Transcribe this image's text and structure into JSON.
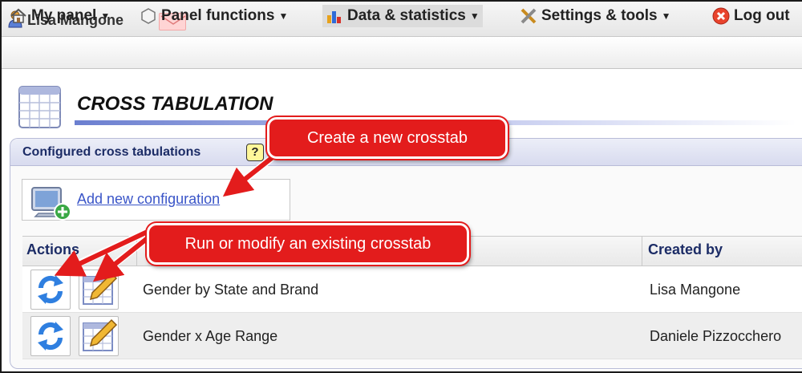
{
  "user": {
    "name": "Lisa Mangone"
  },
  "menu": [
    {
      "label": "My panel",
      "icon": "home-icon"
    },
    {
      "label": "Panel functions",
      "icon": "hexagon-icon"
    },
    {
      "label": "Data & statistics",
      "icon": "chart-icon"
    },
    {
      "label": "Settings & tools",
      "icon": "tools-icon"
    },
    {
      "label": "Log out",
      "icon": "logout-icon"
    }
  ],
  "page": {
    "title": "CROSS TABULATION"
  },
  "panel": {
    "title": "Configured cross tabulations",
    "help": "?",
    "add_link": "Add new configuration"
  },
  "table": {
    "headers": [
      "Actions",
      "Created by"
    ],
    "rows": [
      {
        "name": "Gender by State and Brand",
        "created_by": "Lisa Mangone"
      },
      {
        "name": "Gender x Age Range",
        "created_by": "Daniele Pizzocchero"
      }
    ]
  },
  "callouts": {
    "new": "Create a new crosstab",
    "existing": "Run or modify an existing crosstab"
  },
  "colors": {
    "callout": "#e31c1c",
    "link": "#3a55c8",
    "header_text": "#1c2c66"
  }
}
